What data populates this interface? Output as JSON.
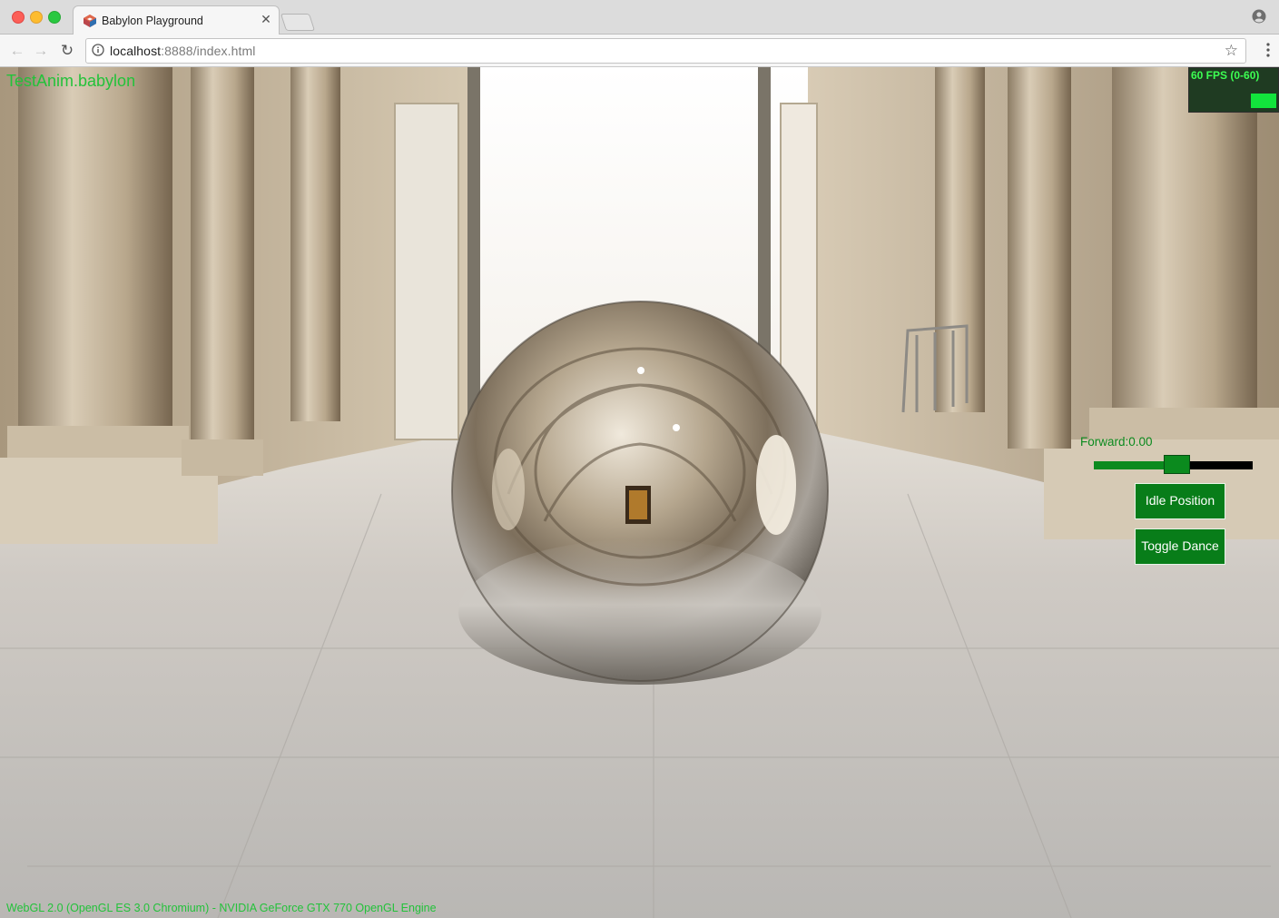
{
  "browser": {
    "tab_title": "Babylon Playground",
    "url_host": "localhost",
    "url_rest": ":8888/index.html"
  },
  "scene": {
    "file_name": "TestAnim.babylon",
    "fps_text": "60 FPS (0-60)",
    "fps_level": 1.0,
    "forward_label": "Forward:0.00",
    "forward_slider_value": 0.52,
    "idle_button": "Idle Position",
    "dance_button": "Toggle Dance",
    "engine_info": "WebGL 2.0 (OpenGL ES 3.0 Chromium) - NVIDIA GeForce GTX 770 OpenGL Engine"
  },
  "colors": {
    "gui_green": "#087d19",
    "overlay_text_green": "#23c23a",
    "fps_bar": "#12e43c"
  }
}
